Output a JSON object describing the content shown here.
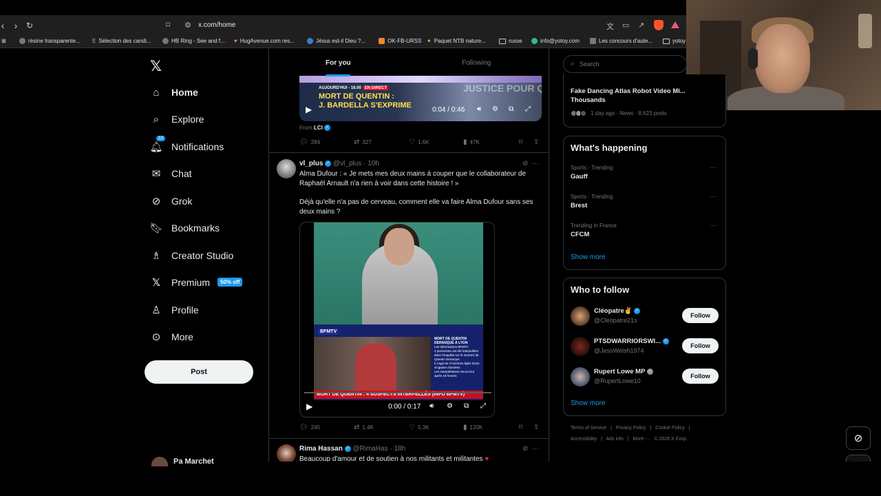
{
  "browser": {
    "url": "x.com/home",
    "bookmarks": [
      {
        "label": "résine transparente...",
        "icon": "globe-icon"
      },
      {
        "label": "Sélection des candi...",
        "icon": "e-icon"
      },
      {
        "label": "HB Ring - See and f...",
        "icon": "globe-icon"
      },
      {
        "label": "HugAvenue.com res...",
        "icon": "heart-icon"
      },
      {
        "label": "Jésus est-il Dieu ?...",
        "icon": "info-icon"
      },
      {
        "label": "OK-FB-URSS",
        "icon": "folder-icon"
      },
      {
        "label": "Paquet NTB nature...",
        "icon": "leaf-icon"
      },
      {
        "label": "russe",
        "icon": "folder-icon"
      },
      {
        "label": "info@yotoy.com",
        "icon": "globe-icon"
      },
      {
        "label": "Les concours d'aute...",
        "icon": "globe-icon"
      },
      {
        "label": "yotoy",
        "icon": "folder-icon"
      }
    ]
  },
  "sidebar": {
    "items": [
      {
        "label": "Home",
        "icon": "home-icon"
      },
      {
        "label": "Explore",
        "icon": "search-icon"
      },
      {
        "label": "Notifications",
        "icon": "bell-icon",
        "badge": "13"
      },
      {
        "label": "Chat",
        "icon": "mail-icon"
      },
      {
        "label": "Grok",
        "icon": "grok-icon"
      },
      {
        "label": "Bookmarks",
        "icon": "bookmark-icon"
      },
      {
        "label": "Creator Studio",
        "icon": "creator-icon"
      },
      {
        "label": "Premium",
        "icon": "x-icon",
        "badge": "50% off"
      },
      {
        "label": "Profile",
        "icon": "person-icon"
      },
      {
        "label": "More",
        "icon": "more-icon"
      }
    ],
    "post_label": "Post",
    "account_name": "Pa Marchet"
  },
  "feed": {
    "tabs": [
      {
        "label": "For you"
      },
      {
        "label": "Following"
      }
    ],
    "tweet1": {
      "video": {
        "banner_time": "AUJOURD'HUI - 16.00",
        "banner_direct": "EN DIRECT",
        "title_line1": "MORT DE QUENTIN :",
        "title_line2": "J. BARDELLA S'EXPRIME",
        "bg_text": "JUSTICE POUR QUENTIN",
        "time": "0:04 / 0:46"
      },
      "from_prefix": "From",
      "from_source": "LCI",
      "stats": {
        "replies": "284",
        "reposts": "327",
        "likes": "1.6K",
        "views": "47K"
      }
    },
    "tweet2": {
      "name": "vl_plus",
      "handle": "@vl_plus",
      "time": "10h",
      "text1": "Alma Dufour : « Je mets mes deux mains à couper que le collaborateur de Raphaël Arnault n'a rien à voir dans cette histoire ! »",
      "text2": "Déjà qu'elle n'a pas de cerveau, comment elle va faire Alma Dufour sans ses deux mains ?",
      "video": {
        "channel": "BFMTV",
        "side_title": "MORT DE QUENTIN DERANQUE À LYON",
        "side_lines": [
          "Les informations BFMTV",
          "4 personnes ont été interpellées dans l'enquête sur le meurtre de Quentin Deranque",
          "Il s'agit de 4 hommes âgés d'une vingtaine d'années",
          "Les interpellations ont eu lieu après 18 heures"
        ],
        "ticker": "MORT DE QUENTIN : 4 SUSPECTS INTERPELLÉS (INFO BFMTV)",
        "time": "0:00 / 0:17"
      },
      "stats": {
        "replies": "245",
        "reposts": "1.4K",
        "likes": "5.3K",
        "views": "120K"
      }
    },
    "tweet3": {
      "name": "Rima Hassan",
      "handle": "@RimaHas",
      "time": "18h",
      "text": "Beaucoup d'amour et de soutien à nos militants et militantes"
    }
  },
  "right": {
    "search_placeholder": "Search",
    "news": {
      "title": "Fake Dancing Atlas Robot Video Mi... Thousands",
      "meta": "1 day ago · News · 8,623 posts"
    },
    "whats_happening": {
      "title": "What's happening",
      "trends": [
        {
          "category": "Sports · Trending",
          "name": "Gauff"
        },
        {
          "category": "Sports · Trending",
          "name": "Brest"
        },
        {
          "category": "Trending in France",
          "name": "CFCM"
        }
      ],
      "show_more": "Show more"
    },
    "who_to_follow": {
      "title": "Who to follow",
      "accounts": [
        {
          "name": "Cléopatre✌️",
          "handle": "@Cleopatre21s",
          "follow": "Follow"
        },
        {
          "name": "PTSDWARRIORSWI...",
          "handle": "@JessWelsh1974",
          "follow": "Follow"
        },
        {
          "name": "Rupert Lowe MP",
          "handle": "@RupertLowe10",
          "follow": "Follow"
        }
      ],
      "show_more": "Show more"
    },
    "footer": [
      "Terms of Service",
      "|",
      "Privacy Policy",
      "|",
      "Cookie Policy",
      "|",
      "Accessibility",
      "|",
      "Ads info",
      "|",
      "More ···",
      "© 2026 X Corp."
    ]
  },
  "colors": {
    "accent": "#1d9bf0",
    "background": "#000000",
    "border": "#2f3336",
    "muted": "#71767b",
    "text": "#e7e9ea"
  }
}
